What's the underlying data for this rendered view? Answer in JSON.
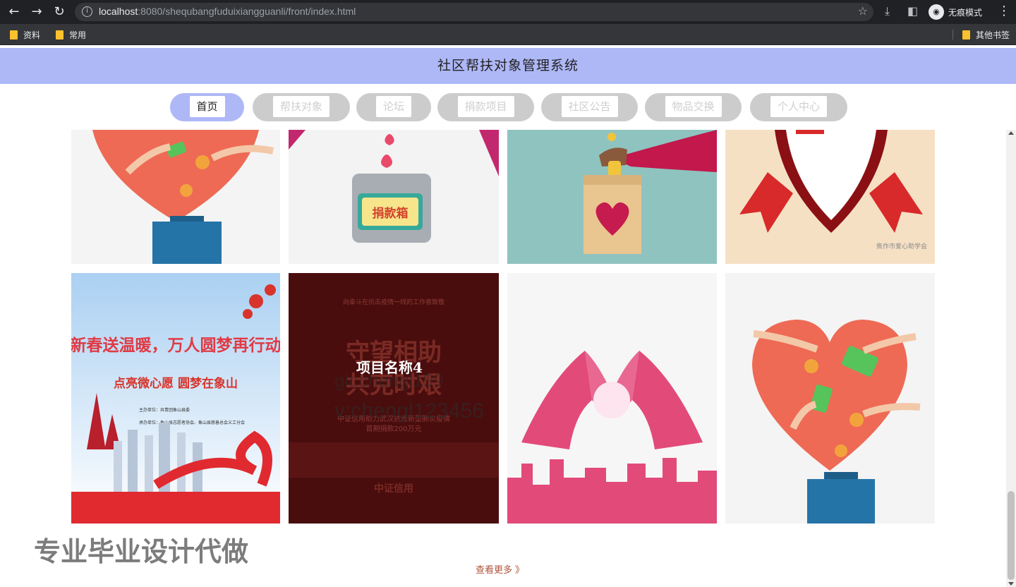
{
  "browser": {
    "url_host": "localhost",
    "url_path": ":8080/shequbangfuduixiangguanli/front/index.html",
    "incognito_label": "无痕模式",
    "bookmarks": [
      {
        "label": "资料",
        "icon": "folder-icon"
      },
      {
        "label": "常用",
        "icon": "folder-icon"
      }
    ],
    "other_bookmarks": "其他书签"
  },
  "site": {
    "title": "社区帮扶对象管理系统",
    "nav": [
      {
        "label": "首页",
        "active": true
      },
      {
        "label": "帮扶对象",
        "active": false
      },
      {
        "label": "论坛",
        "active": false
      },
      {
        "label": "捐款项目",
        "active": false
      },
      {
        "label": "社区公告",
        "active": false
      },
      {
        "label": "物品交换",
        "active": false
      },
      {
        "label": "个人中心",
        "active": false
      }
    ],
    "colors": {
      "header": "#aeb8f7",
      "nav_inactive": "#cccccc",
      "link": "#b0543a"
    }
  },
  "gallery": {
    "tiles": [
      {
        "image": "heart-donation-box",
        "texts": []
      },
      {
        "image": "donation-box-hearts",
        "texts": [
          "捐款箱"
        ]
      },
      {
        "image": "hand-coin-heart-box",
        "texts": []
      },
      {
        "image": "red-ribbon-heart",
        "texts": [
          "焦作市爱心助学会"
        ]
      },
      {
        "image": "spring-warmth-poster",
        "texts": [
          "新春送温暖，万人圆梦再行动",
          "点亮微心愿  圆梦在象山",
          "主办单位：共青团象山县委",
          "承办单位：象山县志愿者协会、象山县慈善总会义工分会"
        ]
      },
      {
        "image": "dark-red-poster",
        "texts": [
          "向奋斗在抗击疫情一线的工作者致敬",
          "守望相助",
          "共克时艰",
          "中证信用助力武汉抗击新型肺炎疫情",
          "首期捐款200万元",
          "中证信用"
        ],
        "overlay_title": "项目名称4"
      },
      {
        "image": "hands-heart-city",
        "texts": []
      },
      {
        "image": "heart-donation-box-large",
        "texts": []
      }
    ]
  },
  "watermarks": {
    "line1": "git:chengl199",
    "line2": "v:chengl123456",
    "line3": "专业毕业设计代做"
  },
  "more_link": "查看更多 》"
}
